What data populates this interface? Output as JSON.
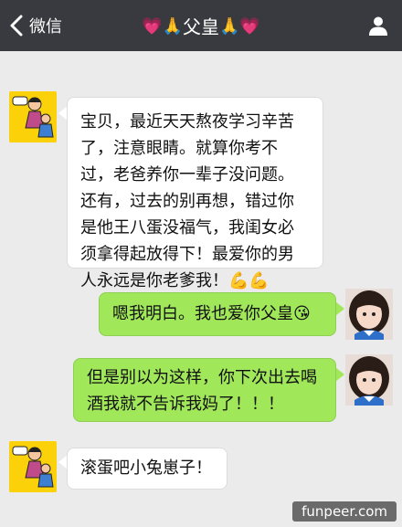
{
  "header": {
    "back_label": "微信",
    "title_prefix": "💗🙏",
    "title": "父皇",
    "title_suffix": "🙏💗"
  },
  "messages": [
    {
      "side": "left",
      "text": "宝贝，最近天天熬夜学习辛苦了，注意眼睛。就算你考不过，老爸养你一辈子没问题。还有，过去的别再想，错过你是他王八蛋没福气，我闺女必须拿得起放得下！最爱你的男人永远是你老爹我！",
      "emoji": "💪💪"
    },
    {
      "side": "right",
      "text": "嗯我明白。我也爱你父皇",
      "emoji": "😘"
    },
    {
      "side": "right",
      "text": "但是别以为这样，你下次出去喝酒我就不告诉我妈了！！！",
      "emoji": ""
    },
    {
      "side": "left",
      "text": "滚蛋吧小兔崽子！",
      "emoji": ""
    }
  ],
  "watermark": "funpeer.com",
  "colors": {
    "topbar": "#393a3f",
    "chat_bg": "#ebebeb",
    "bubble_green": "#a0e75a",
    "bubble_white": "#ffffff"
  },
  "icons": {
    "back": "chevron-left-icon",
    "profile": "person-icon"
  }
}
